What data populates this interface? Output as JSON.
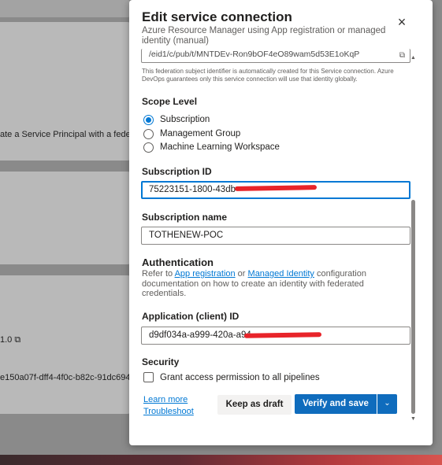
{
  "background": {
    "line1": "ate a Service Principal with a fede",
    "line2": "1.0",
    "line3": "e150a07f-dff4-4f0c-b82c-91dc694"
  },
  "dialog": {
    "title": "Edit service connection",
    "subtitle": "Azure Resource Manager using App registration or managed identity (manual)",
    "close_icon": "×",
    "federation_field_value": "/eid1/c/pub/t/MNTDEv-Ron9bOF4eO89wam5d53E1oKqP",
    "federation_hint": "This federation subject identifier is automatically created for this Service connection. Azure DevOps guarantees only this service connection will use that identity globally.",
    "scope": {
      "label": "Scope Level",
      "options": [
        "Subscription",
        "Management Group",
        "Machine Learning Workspace"
      ],
      "selected": "Subscription"
    },
    "subscription_id": {
      "label": "Subscription ID",
      "value": "75223151-1800-43db-"
    },
    "subscription_name": {
      "label": "Subscription name",
      "value": "TOTHENEW-POC"
    },
    "authentication": {
      "heading": "Authentication",
      "text_prefix": "Refer to ",
      "link1": "App registration",
      "text_mid": " or ",
      "link2": "Managed Identity",
      "text_suffix": " configuration documentation on how to create an identity with federated credentials."
    },
    "application_id": {
      "label": "Application (client) ID",
      "value": "d9df034a-a999-420a-a94"
    },
    "security": {
      "heading": "Security",
      "checkbox_label": "Grant access permission to all pipelines"
    },
    "footer": {
      "learn_more": "Learn more",
      "troubleshoot": "Troubleshoot",
      "draft_label": "Keep as draft",
      "verify_label": "Verify and save"
    }
  },
  "colors": {
    "primary": "#0f6cbd",
    "link": "#0078d4",
    "redaction": "#e8242a"
  }
}
